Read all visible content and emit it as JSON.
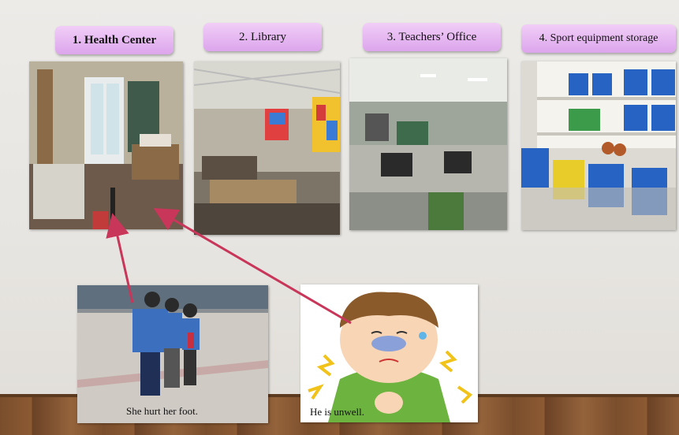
{
  "labels": [
    {
      "text": "1. Health Center"
    },
    {
      "text": "2. Library"
    },
    {
      "text": "3. Teachers’ Office"
    },
    {
      "text": "4. Sport equipment storage"
    }
  ],
  "captions": {
    "foot": "She hurt her foot.",
    "unwell": "He is unwell."
  },
  "colors": {
    "label_top": "#f1cef7",
    "label_bottom": "#dca5ec",
    "arrow": "#c8365a"
  }
}
